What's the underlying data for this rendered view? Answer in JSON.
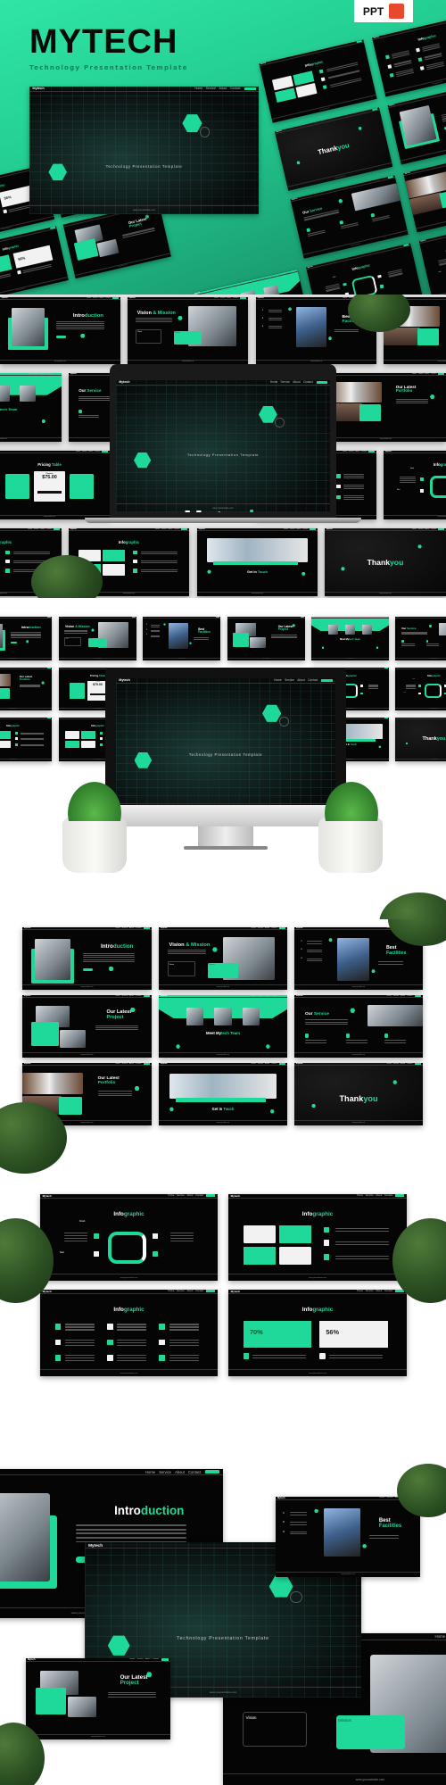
{
  "header": {
    "title": "MYTECH",
    "subtitle": "Technology Presentation Template",
    "badge": "PPT",
    "badge_icon": "powerpoint-icon"
  },
  "colors": {
    "accent": "#1ed99a",
    "slide_bg": "#050505",
    "header_bg": "#22c98f",
    "badge_icon": "#e8492d"
  },
  "brand": "Mytech",
  "nav": [
    "Home",
    "Service",
    "About",
    "Contact"
  ],
  "website": "www.yourwebsite.com",
  "hero": {
    "a": "My",
    "b": "tech",
    "subtitle": "Technology Presentation Template"
  },
  "titles": {
    "intro": {
      "a": "Intro",
      "b": "duction"
    },
    "vision": {
      "a": "Vision ",
      "b": "& Mission"
    },
    "facilities": {
      "a": "Best ",
      "b": "Facilities"
    },
    "project": {
      "a": "Our Latest ",
      "b": "Project"
    },
    "team": {
      "a": "Meet My",
      "b": "tech Team"
    },
    "service": {
      "a": "Our ",
      "b": "Service"
    },
    "portfolio": {
      "a": "Our Latest ",
      "b": "Portfolio"
    },
    "touch": {
      "a": "Get In ",
      "b": "Touch"
    },
    "thanks": {
      "a": "Thank",
      "b": "you"
    },
    "pricing": {
      "a": "Pricing ",
      "b": "Table"
    },
    "info": {
      "a": "Info",
      "b": "graphic"
    }
  },
  "pricing": {
    "plan": "Premium",
    "price": "$75.00"
  },
  "vision_box": {
    "vision": "Vision",
    "mission": "Mission"
  },
  "facilities_list": [
    "1",
    "2",
    "3"
  ],
  "infographic": {
    "pct1": "70%",
    "pct2": "56%",
    "start": "Start",
    "finish": "Finish"
  }
}
